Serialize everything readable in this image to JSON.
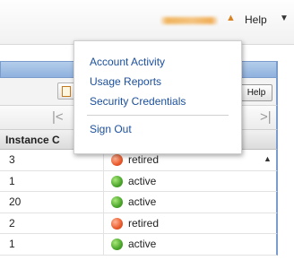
{
  "header": {
    "account_name": "",
    "help_label": "Help"
  },
  "account_menu": {
    "items": [
      {
        "label": "Account Activity"
      },
      {
        "label": "Usage Reports"
      },
      {
        "label": "Security Credentials"
      }
    ],
    "sign_out_label": "Sign Out"
  },
  "toolbar": {
    "help_button_label": "Help"
  },
  "pager": {
    "first_glyph": "|<",
    "last_glyph": ">|"
  },
  "table": {
    "columns": [
      "Instance C"
    ],
    "rows": [
      {
        "instance_count": "3",
        "status": "retired"
      },
      {
        "instance_count": "1",
        "status": "active"
      },
      {
        "instance_count": "20",
        "status": "active"
      },
      {
        "instance_count": "2",
        "status": "retired"
      },
      {
        "instance_count": "1",
        "status": "active"
      }
    ]
  },
  "colors": {
    "link": "#1b4f9c",
    "panel_header": "#8fb1de",
    "status_active": "#4aa52a",
    "status_retired": "#ea5a2a",
    "account_name": "#e79a2c"
  }
}
